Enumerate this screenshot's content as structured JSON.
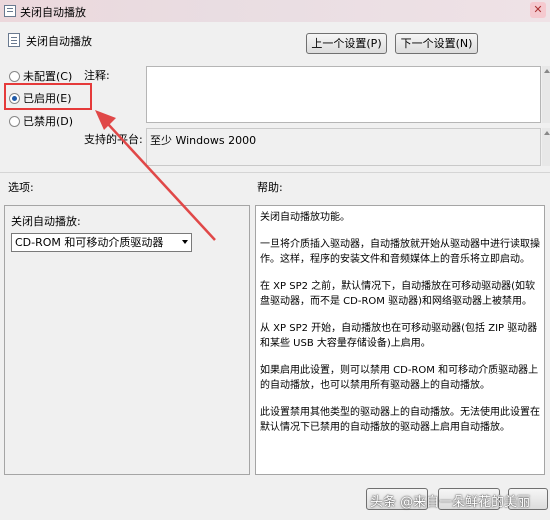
{
  "window": {
    "title": "关闭自动播放"
  },
  "header": {
    "title": "关闭自动播放"
  },
  "nav": {
    "prev": "上一个设置(P)",
    "next": "下一个设置(N)"
  },
  "state": {
    "options": [
      {
        "label": "未配置(C)",
        "checked": false
      },
      {
        "label": "已启用(E)",
        "checked": true
      },
      {
        "label": "已禁用(D)",
        "checked": false
      }
    ]
  },
  "comment": {
    "label": "注释:"
  },
  "platform": {
    "label": "支持的平台:",
    "value": "至少 Windows 2000"
  },
  "sections": {
    "options": "选项:",
    "help": "帮助:"
  },
  "options_panel": {
    "title": "关闭自动播放:",
    "selected": "CD-ROM 和可移动介质驱动器"
  },
  "help": {
    "paragraphs": [
      "关闭自动播放功能。",
      "一旦将介质插入驱动器，自动播放就开始从驱动器中进行读取操作。这样，程序的安装文件和音频媒体上的音乐将立即启动。",
      "在 XP SP2 之前，默认情况下，自动播放在可移动驱动器(如软盘驱动器，而不是 CD-ROM 驱动器)和网络驱动器上被禁用。",
      "从 XP SP2 开始，自动播放也在可移动驱动器(包括 ZIP 驱动器和某些 USB 大容量存储设备)上启用。",
      "如果启用此设置，则可以禁用 CD-ROM 和可移动介质驱动器上的自动播放，也可以禁用所有驱动器上的自动播放。",
      "此设置禁用其他类型的驱动器上的自动播放。无法使用此设置在默认情况下已禁用的自动播放的驱动器上启用自动播放。"
    ]
  },
  "watermark": "头条 @来自一朵鲜花的美丽",
  "colors": {
    "highlight": "#e53a3a",
    "arrow": "#e04848"
  }
}
